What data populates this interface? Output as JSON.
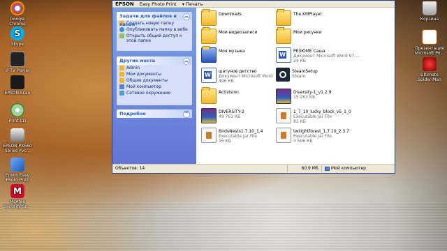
{
  "desktop": {
    "left_icons": [
      {
        "label": "Google Chrome",
        "name": "chrome-icon",
        "color": "#db4437"
      },
      {
        "label": "Skype",
        "name": "skype-icon",
        "color": "#00aff0"
      },
      {
        "label": "IP-TV Player",
        "name": "tv-icon",
        "color": "#2a2a2a"
      },
      {
        "label": "EPSON Scan",
        "name": "scanner-icon",
        "color": "#1a1a1a"
      },
      {
        "label": "Print CD",
        "name": "cd-icon",
        "color": "#3a7c3a"
      },
      {
        "label": "EPSON PX660 Series Pvc...",
        "name": "printer-icon",
        "color": "#555"
      },
      {
        "label": "Epson Easy Photo Print",
        "name": "photo-print-icon",
        "color": "#1e5bb5"
      },
      {
        "label": "McAfee Security Sc...",
        "name": "mcafee-icon",
        "color": "#c8102e"
      }
    ],
    "right_icons": [
      {
        "label": "Корзина",
        "name": "recycle-bin-icon",
        "color": "#ddd"
      },
      {
        "label": "Презентация Microsoft Po...",
        "name": "powerpoint-icon",
        "color": "#d04a02"
      },
      {
        "label": "Ultimate Spider-Man",
        "name": "spiderman-icon",
        "color": "#b30000"
      }
    ]
  },
  "window": {
    "brand": "EPSON",
    "menu": [
      "Easy Photo Print",
      "Печать"
    ],
    "tasks": {
      "title": "Задачи для файлов и папок",
      "items": [
        "Создать новую папку",
        "Опубликовать папку в вебе",
        "Открыть общий доступ к этой папке"
      ]
    },
    "places": {
      "title": "Другие места",
      "items": [
        "Admin",
        "Мои документы",
        "Общие документы",
        "Мой компьютер",
        "Сетевое окружение"
      ]
    },
    "details": {
      "title": "Подробно"
    },
    "files": [
      {
        "name": "Downloads",
        "type": "",
        "size": "",
        "kind": "folder"
      },
      {
        "name": "The KMPlayer",
        "type": "",
        "size": "",
        "kind": "folder"
      },
      {
        "name": "Мои видеозаписи",
        "type": "",
        "size": "",
        "kind": "folder"
      },
      {
        "name": "Мои рисунки",
        "type": "",
        "size": "",
        "kind": "folder"
      },
      {
        "name": "Моя музыка",
        "type": "",
        "size": "",
        "kind": "folder"
      },
      {
        "name": "РЕЗЮМЕ Саша",
        "type": "Документ Microsoft Word 97-...",
        "size": "24 КБ",
        "kind": "doc"
      },
      {
        "name": "шатунов детство",
        "type": "Документ Microsoft Word",
        "size": "496 КБ",
        "kind": "doc"
      },
      {
        "name": "SteamSetup",
        "type": "Steam",
        "size": "",
        "kind": "steam"
      },
      {
        "name": "Activision",
        "type": "",
        "size": "",
        "kind": "folder"
      },
      {
        "name": "Diversity-1_v1.2.9",
        "type": "15 263 КБ",
        "size": "",
        "kind": "rar"
      },
      {
        "name": "DIVERSITY-2",
        "type": "49 761 КБ",
        "size": "",
        "kind": "rar"
      },
      {
        "name": "1_7_10_lucky_block_v5_1_0",
        "type": "Executable Jar File",
        "size": "82 КБ",
        "kind": "jar"
      },
      {
        "name": "BirdsNests1.7.10_1.4",
        "type": "Executable Jar File",
        "size": "16 КБ",
        "kind": "jar"
      },
      {
        "name": "twilightforest_1.7.10_2.3.7",
        "type": "Executable Jar File",
        "size": "3 596 КБ",
        "kind": "jar"
      }
    ],
    "status": {
      "objects": "Объектов: 14",
      "size": "60,9 МБ",
      "location": "Мой компьютер"
    }
  }
}
